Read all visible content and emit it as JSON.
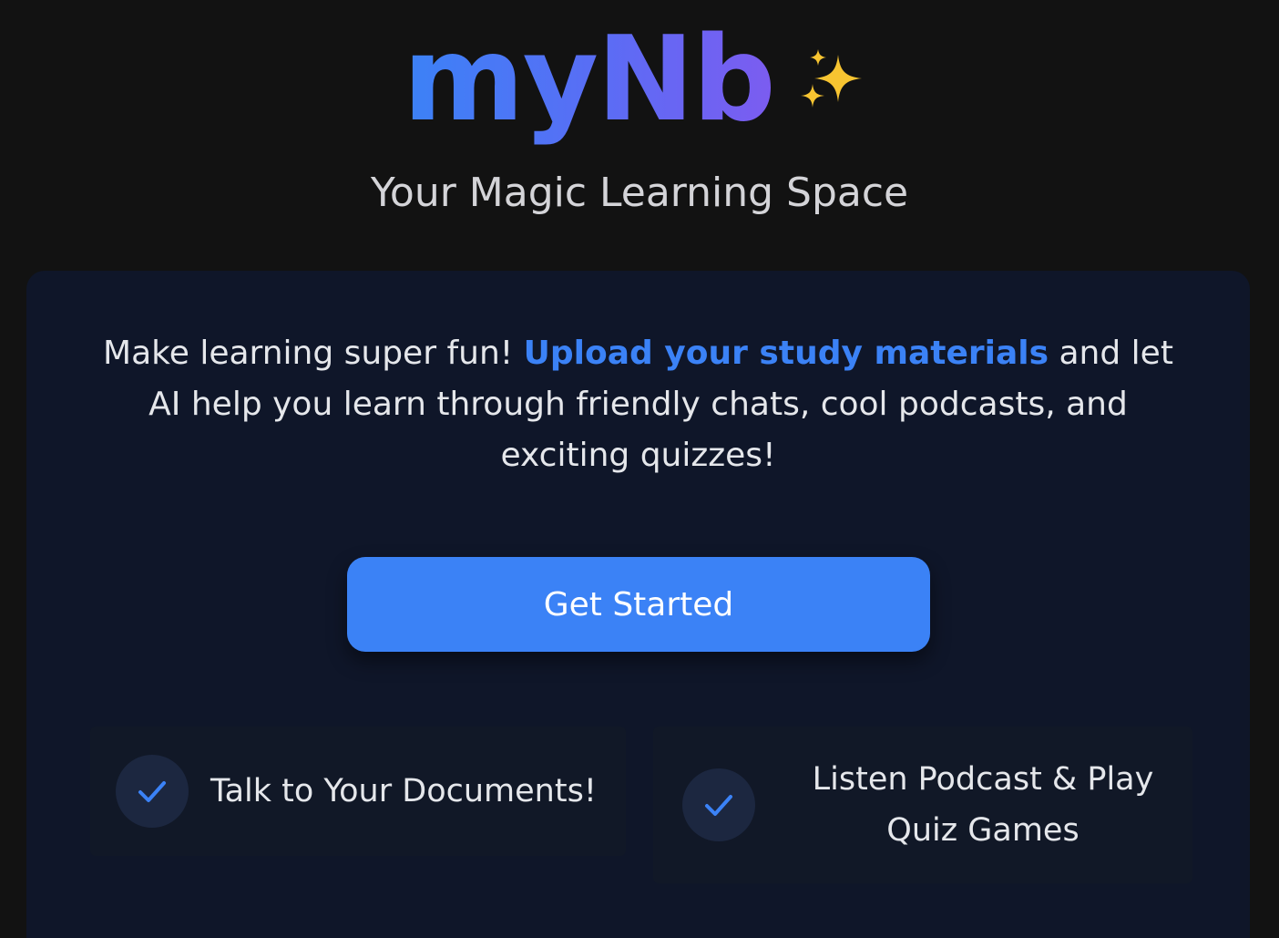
{
  "brand": {
    "name": "myNb",
    "icon": "sparkles-icon",
    "gradient": [
      "#3b82f6",
      "#7c5cf0"
    ]
  },
  "tagline": "Your Magic Learning Space",
  "card": {
    "intro_before": "Make learning super fun! ",
    "intro_link": "Upload your study materials",
    "intro_after": " and let AI help you learn through friendly chats, cool podcasts, and exciting quizzes!",
    "cta_label": "Get Started",
    "features": [
      {
        "icon": "check-icon",
        "label": "Talk to Your Documents!"
      },
      {
        "icon": "check-icon",
        "label": "Listen Podcast & Play Quiz Games"
      }
    ]
  },
  "colors": {
    "background": "#121212",
    "card": "#0f1629",
    "accent": "#3b82f6",
    "text": "#e5e7eb"
  }
}
